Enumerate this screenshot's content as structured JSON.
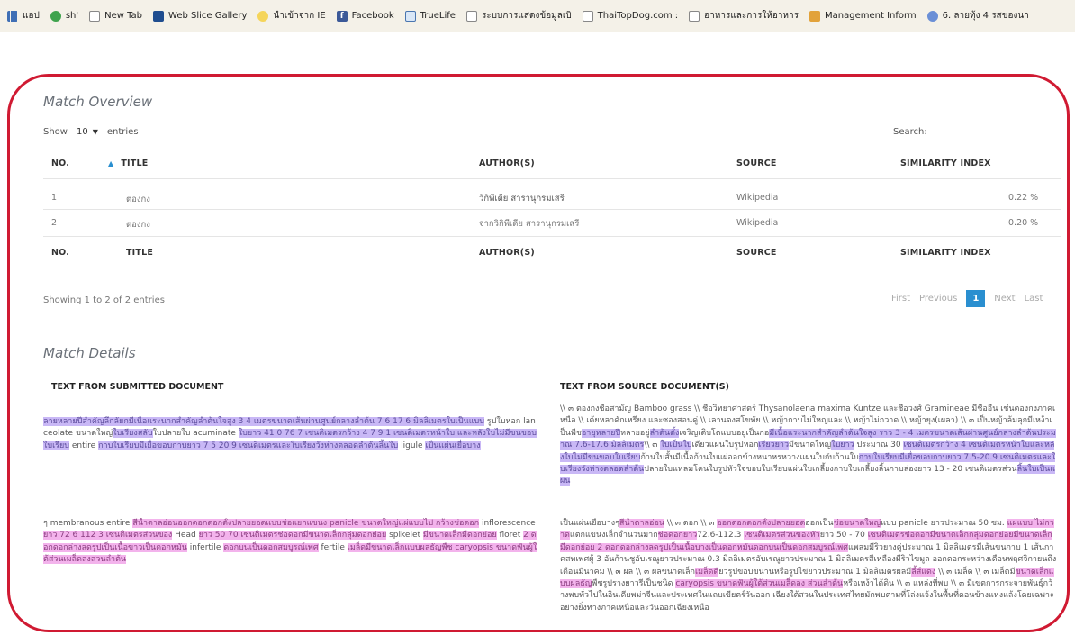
{
  "bookmarks": [
    {
      "label": "แอป",
      "icon": "apps-grid-icon"
    },
    {
      "label": "sh'",
      "icon": "green-dot-icon"
    },
    {
      "label": "New Tab",
      "icon": "page-icon"
    },
    {
      "label": "Web Slice Gallery",
      "icon": "web-slice-icon"
    },
    {
      "label": "นำเข้าจาก IE",
      "icon": "ie-folder-icon"
    },
    {
      "label": "Facebook",
      "icon": "facebook-icon"
    },
    {
      "label": "TrueLife",
      "icon": "home-icon"
    },
    {
      "label": "ระบบการแสดงข้อมูลเบิ",
      "icon": "page-icon"
    },
    {
      "label": "ThaiTopDog.com :",
      "icon": "page-icon"
    },
    {
      "label": "อาหารและการให้อาหาร",
      "icon": "page-icon"
    },
    {
      "label": "Management Inform",
      "icon": "management-icon"
    },
    {
      "label": "6. ลายทุ้ง 4 รสของนา",
      "icon": "number-six-icon"
    }
  ],
  "overview": {
    "title": "Match Overview",
    "show_label": "Show",
    "entries_value": "10",
    "entries_label": "entries",
    "search_label": "Search:",
    "columns": {
      "no": "NO.",
      "title": "TITLE",
      "authors": "AUTHOR(S)",
      "source": "SOURCE",
      "similarity": "SIMILARITY INDEX"
    },
    "rows": [
      {
        "no": "1",
        "title": "ตองกง",
        "authors": "วิกิพีเดีย สารานุกรมเสรี",
        "source": "Wikipedia",
        "similarity": "0.22 %"
      },
      {
        "no": "2",
        "title": "ตองกง",
        "authors": "จากวิกิพีเดีย สารานุกรมเสรี",
        "source": "Wikipedia",
        "similarity": "0.20 %"
      }
    ],
    "summary": "Showing 1 to 2 of 2 entries",
    "pager": {
      "first": "First",
      "previous": "Previous",
      "current": "1",
      "next": "Next",
      "last": "Last"
    }
  },
  "details": {
    "title": "Match Details",
    "submitted_header": "TEXT FROM SUBMITTED DOCUMENT",
    "source_header": "TEXT FROM SOURCE DOCUMENT(S)",
    "submitted_blocks": [
      [
        {
          "t": "ลายหลายปีสำคัญลึกลัยกมีเนื้อแระนากสำคัญลำต้นใจสูง 3 4 ",
          "h": "p"
        },
        {
          "t": "เมตรขนาดเส้นผ่านศูนย์กลางลำต้น 7 6 17 6 มิลลิเมตรใบเป็นแบบ",
          "h": "p"
        },
        {
          "t": " รูปใบหอก lanceolate ขนาดใหญ่",
          "h": ""
        },
        {
          "t": "ใบเรียงสลับ",
          "h": "p"
        },
        {
          "t": "ใบปลายใบ acuminate ",
          "h": ""
        },
        {
          "t": "ใบยาว 41 0 76 7 เซนติเมตรกว้าง 4 7 9 1 เซนติเมตรหน้าใบ และหลังใบไม่มีขนขอบใบเรียบ",
          "h": "p"
        },
        {
          "t": " entire ",
          "h": ""
        },
        {
          "t": "กาบใบเรียบมีเยื่อขอบกาบยาว 7 5 20 9 เซนติเมตรและใบเรียงวังห่างตลอดลำต้นลิ้นใบ",
          "h": "p"
        },
        {
          "t": " ligule ",
          "h": ""
        },
        {
          "t": "เป็นแผ่นเยื่อบาง",
          "h": "p"
        }
      ],
      [
        {
          "t": "ๆ membranous entire ",
          "h": ""
        },
        {
          "t": "สีน้ำตาลอ่อนออกดอกดอกตั้งปลายยอดแบบช่อแยกแขนง panicle ขนาดใหญ่แผ่แบบไป กว้างช่อดอก",
          "h": "m"
        },
        {
          "t": " inflorescence ",
          "h": ""
        },
        {
          "t": "ยาว 72 6 112 3 เซนติเมตรส่วนของ",
          "h": "m"
        },
        {
          "t": " Head ",
          "h": ""
        },
        {
          "t": "ยาว 50 70 เซนติเมตรช่อดอกมีขนาดเล็กกลุ่มดอกย่อย",
          "h": "m"
        },
        {
          "t": " spikelet ",
          "h": ""
        },
        {
          "t": "มีขนาดเล็กมีดอกย่อย",
          "h": "m"
        },
        {
          "t": " floret ",
          "h": ""
        },
        {
          "t": "2 ดอกดอกล่างลดรูปเป็นเนื้อขาวเป็นดอกหมัน",
          "h": "m"
        },
        {
          "t": " infertile ",
          "h": ""
        },
        {
          "t": "ดอกบนเป็นดอกสมบูรณ์เพศ",
          "h": "m"
        },
        {
          "t": " fertile ",
          "h": ""
        },
        {
          "t": "เมล็ดมีขนาดเล็กแบบผลธัญพืช caryopsis ขนาดฟันผู้ใต้ส่วนเมล็ดลงส่วนลำต้น",
          "h": "m"
        }
      ]
    ],
    "source_blocks": [
      [
        {
          "t": "\\\\ ๓ ตองกงชื่อสามัญ Bamboo grass \\\\ ชื่อวิทยาศาสตร์ Thysanolaena maxima Kuntze และชื่อวงศ์ Gramineae มีชื่ออื่น เช่นตองกงภาคเหนือ \\\\ เค้ยหลาคักเหรียง และซองสอนคู่ \\\\ เลานดงสโขทัย \\\\ หญ้ากาบไม่ใหญ่และ \\\\ หญ้าไม่กวาด \\\\ หญ้ายุง(เผลา) \\\\ ๓ เป็นหญ้าล้มลุกมีเหง้าเป็นพืช",
          "h": ""
        },
        {
          "t": "อายุหลายปี",
          "h": "p"
        },
        {
          "t": "หลายอยู่",
          "h": ""
        },
        {
          "t": "ลำต้นตั้ง",
          "h": "p"
        },
        {
          "t": "เจริญเติบโตแบบอยู่เป็นกอ",
          "h": ""
        },
        {
          "t": "มีเนื้อแระนากสำคัญลำต้นใจสูง ราว 3 - 4 เมตรขนาดเส้นผ่านศูนย์กลางลำต้นประมาณ 7.6-17.6 มิลลิเมตร",
          "h": "p"
        },
        {
          "t": "\\\\ ๓ ",
          "h": ""
        },
        {
          "t": "ใบเป็นใบ",
          "h": "p"
        },
        {
          "t": "เดียวแผ่นใบรูปหอก",
          "h": ""
        },
        {
          "t": "เรียวยาว",
          "h": "p"
        },
        {
          "t": "มีขนาดใหญ่",
          "h": ""
        },
        {
          "t": "ใบยาว",
          "h": "p"
        },
        {
          "t": " ประมาณ 30 ",
          "h": ""
        },
        {
          "t": "เซนติเมตรกว้าง 4 เซนติเมตรหน้าใบและหลังใบไม่มีขนขอบใบเรียบ",
          "h": "p"
        },
        {
          "t": "ก้านใบสั้นมีเนื้อก้านใบแผ่ออกข้างหนาหรหวางแผ่นใบกับก้านใบ",
          "h": ""
        },
        {
          "t": "กาบใบเรียบมีเยื่อขอบกาบยาว 7.5-20.9 เซนติเมตรและใบเรียงวังห่างตลอดลำต้น",
          "h": "p"
        },
        {
          "t": "ปลายใบแหลมโคนใบรูปหัวใจขอบใบเรียบแผ่นใบเกลี้ยงกาบใบเกลี้ยงลิ้นกาบล่องยาว 13 - 20 เซนติเมตรส่วน",
          "h": ""
        },
        {
          "t": "ลิ้นใบเป็นแผ่น",
          "h": "p"
        }
      ],
      [
        {
          "t": "เป็นแผ่นเยื่อบางๆ",
          "h": ""
        },
        {
          "t": "สีน้ำตาลอ่อน",
          "h": "m"
        },
        {
          "t": " \\\\ ๓ ดอก \\\\ ๓ ",
          "h": ""
        },
        {
          "t": "ออกดอกดอกตั้งปลายยอด",
          "h": "m"
        },
        {
          "t": "ออกเป็น",
          "h": ""
        },
        {
          "t": "ช่อขนาดใหญ่",
          "h": "m"
        },
        {
          "t": "แบบ panicle ยาวประมาณ 50 ซม. ",
          "h": ""
        },
        {
          "t": "แผ่แบบ ไม่กวาด",
          "h": "m"
        },
        {
          "t": "แตกแขนงเล็กจำนวนมาก",
          "h": ""
        },
        {
          "t": "ช่อดอกยาว",
          "h": "m"
        },
        {
          "t": "72.6-112.3 ",
          "h": ""
        },
        {
          "t": "เซนติเมตรส่วนของหัว",
          "h": "m"
        },
        {
          "t": "ยาว 50 - 70 ",
          "h": ""
        },
        {
          "t": "เซนติเมตรช่อดอกมีขนาดเล็กกลุ่ม",
          "h": "m"
        },
        {
          "t": "ดอกย่อยมีขนาดเล็กมีดอกย่อย 2 ดอกดอกล่างลดรูปเป็นเนื้อบางเป็นดอกหมันดอกบนเป็นดอกสมบูรณ์เพศ",
          "h": "m"
        },
        {
          "t": "แพลมมีริวยางคู่ประมาณ 1 มิลลิเมตรมีเส้นขนกาบ 1 เส้นกาคสทเพศผู้ 3 อันก้านชูอับเรณูยาวประมาณ 0.3 มิลลิเมตรอับเรณูยาวประมาณ 1 มิลลิเมตรสีเหลืองมีริวไขมูล ออกดอกระหว่างเดือนพฤศจิกายนถึงเดือนมีนาคม \\\\ ๓ ผล \\\\ ๓ ผลขนาดเล็ก",
          "h": ""
        },
        {
          "t": "เมล็ดดี",
          "h": "m"
        },
        {
          "t": "ยวรูปขอบขนานหรือรูปไข่ยาวประมาณ 1 มิลลิเมตรผลมี",
          "h": ""
        },
        {
          "t": "ลี้ส์แดง",
          "h": "m"
        },
        {
          "t": " \\\\ ๓ เมล็ด \\\\ ๓ เมล็ดมี",
          "h": ""
        },
        {
          "t": "ขนาดเล็กแบบผลธัญ",
          "h": "m"
        },
        {
          "t": "พืชรูปรางยาวรีเป็นชนิด ",
          "h": ""
        },
        {
          "t": "caryopsis ขนาดฟันผู้ใต้ส่วนเมล็ดลง ส่วนลำต้น",
          "h": "m"
        },
        {
          "t": "หรือเหง้าได้ดิน \\\\ ๓ แหล่งที่พบ \\\\ ๓ มีเขตการกระจายพันธุ์กว้างพบทั่วไปในอินเดียพม่าจีนและประเทศในแถบเขียตร์วันออก เฉียงใต้สวนในประเทศไทยมักพบตามที่โล่งแจ้งในพื้นที่ดอนข้างแห่งแล้งโดยเฉพาะอย่างยิ่งทางภาคเหนือและวันออกเฉียงเหนือ",
          "h": ""
        }
      ]
    ]
  }
}
